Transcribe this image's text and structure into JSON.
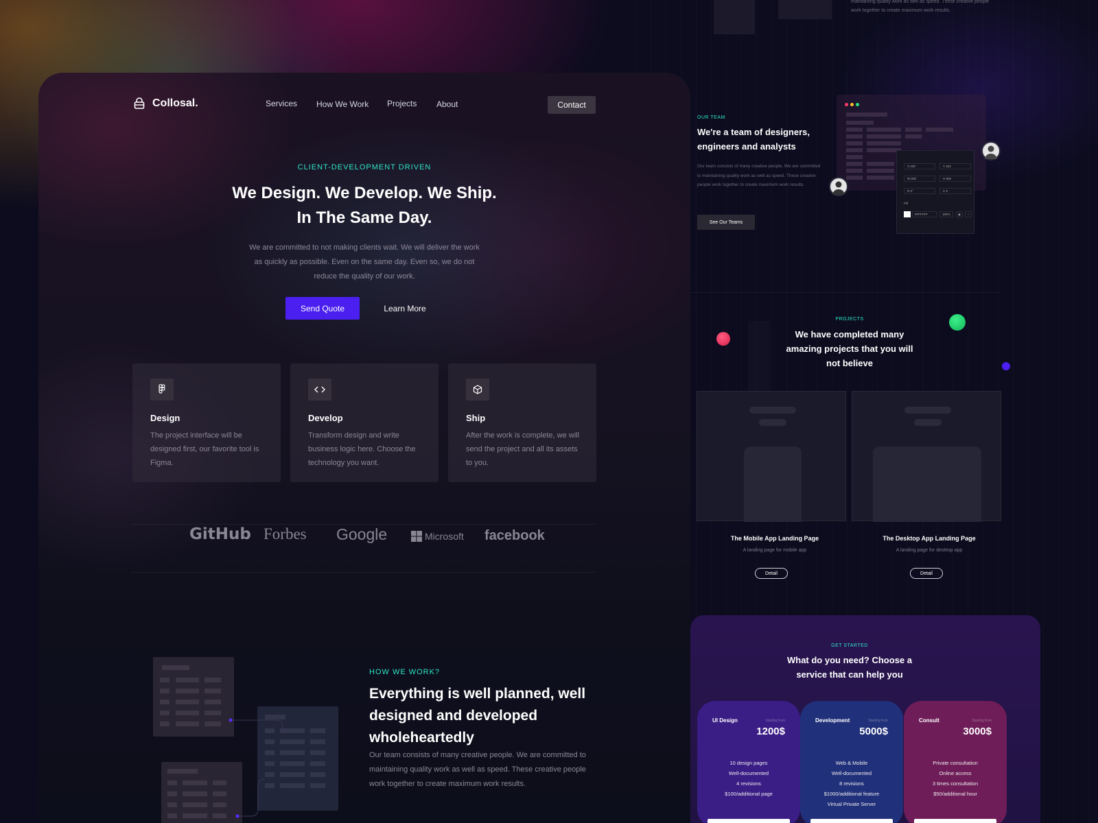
{
  "nav": {
    "logo": "Collosal.",
    "items": [
      "Services",
      "How We Work",
      "Projects",
      "About"
    ],
    "contact": "Contact"
  },
  "hero": {
    "eyebrow": "CLIENT-DEVELOPMENT DRIVEN",
    "title_line1": "We Design. We Develop. We Ship.",
    "title_line2": "In The Same Day.",
    "desc_line1": "We are committed to not making clients wait. We will deliver the work",
    "desc_line2": "as quickly as possible. Even on the same day. Even so, we do not",
    "desc_line3": "reduce the quality of our work.",
    "primary_button": "Send Quote",
    "secondary_button": "Learn More"
  },
  "services": [
    {
      "title": "Design",
      "desc": "The project interface will be designed first, our favorite tool is Figma.",
      "icon": "figma-icon"
    },
    {
      "title": "Develop",
      "desc": "Transform design and write business logic here. Choose the technology you want.",
      "icon": "code-icon"
    },
    {
      "title": "Ship",
      "desc": "After the work is complete, we will send the project and all its assets to you.",
      "icon": "box-icon"
    }
  ],
  "brands": [
    "GitHub",
    "Forbes",
    "Google",
    "Microsoft",
    "facebook"
  ],
  "how": {
    "eyebrow": "HOW WE WORK?",
    "title": "Everything is well planned, well designed and developed wholeheartedly",
    "desc": "Our team consists of many creative people. We are committed to maintaining quality work as well as speed. These creative people work together to create maximum work results."
  },
  "top_snippet": {
    "line1": "maintaining quality work as well as speed. These creative people",
    "line2": "work together to create maximum work results."
  },
  "team": {
    "eyebrow": "OUR TEAM",
    "title": "We're a team of designers, engineers and analysts",
    "desc": "Our team consists of many creative people. We are committed to maintaining quality work as well as speed. These creative people work together to create maximum work results.",
    "button": "See Our Teams",
    "inspector": {
      "x": "X  230",
      "y": "Y  343",
      "w": "W  500",
      "h": "H  500",
      "r": "R  0°",
      "c": "C  5",
      "fill_label": "Fill",
      "fill_value": "#FFFFFF",
      "opacity": "100%"
    }
  },
  "projects": {
    "eyebrow": "PROJECTS",
    "title": "We have completed many amazing projects that you will not believe",
    "items": [
      {
        "title": "The Mobile App Landing Page",
        "desc": "A landing page for mobile app",
        "button": "Detail"
      },
      {
        "title": "The Desktop App Landing Page",
        "desc": "A landing page for desktop app",
        "button": "Detail"
      }
    ]
  },
  "pricing": {
    "eyebrow": "GET STARTED",
    "title": "What do you need? Choose a service that can help you",
    "plans": [
      {
        "name": "UI Design",
        "starting": "Starting from",
        "price": "1200$",
        "features": [
          "10 design pages",
          "Well-documented",
          "4 revisions",
          "$100/additional page"
        ],
        "color": "#3b1d86"
      },
      {
        "name": "Development",
        "starting": "Starting from",
        "price": "5000$",
        "features": [
          "Web & Mobile",
          "Well-documented",
          "8 revisions",
          "$1000/additional feature",
          "Virtual Private Server"
        ],
        "color": "#21307a"
      },
      {
        "name": "Consult",
        "starting": "Starting from",
        "price": "3000$",
        "features": [
          "Private consultation",
          "Online access",
          "3 times consultation",
          "$50/additional hour"
        ],
        "color": "#6e1d58"
      }
    ]
  },
  "colors": {
    "accent": "#4a1ff0",
    "eyebrow": "#2ee5c6"
  }
}
